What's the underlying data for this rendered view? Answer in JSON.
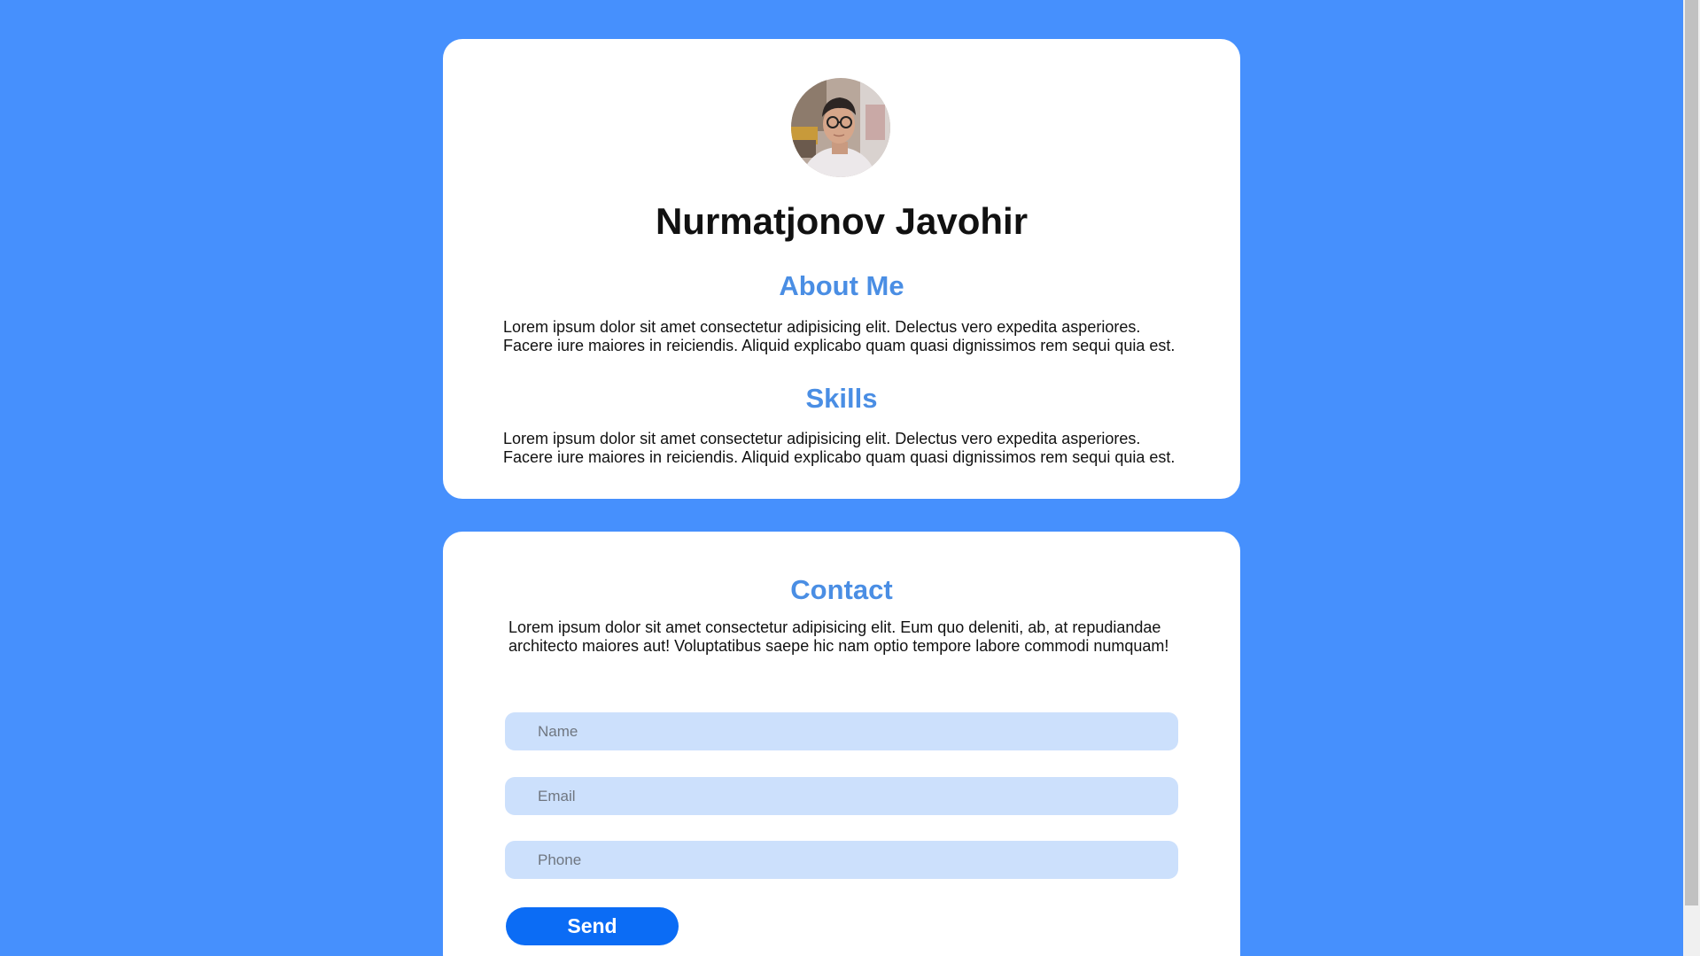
{
  "profile": {
    "name": "Nurmatjonov Javohir",
    "avatar_icon": "profile-photo"
  },
  "about": {
    "heading": "About Me",
    "text": "Lorem ipsum dolor sit amet consectetur adipisicing elit. Delectus vero expedita asperiores. Facere iure maiores in reiciendis. Aliquid explicabo quam quasi dignissimos rem sequi quia est."
  },
  "skills": {
    "heading": "Skills",
    "text": "Lorem ipsum dolor sit amet consectetur adipisicing elit. Delectus vero expedita asperiores. Facere iure maiores in reiciendis. Aliquid explicabo quam quasi dignissimos rem sequi quia est."
  },
  "contact": {
    "heading": "Contact",
    "text": "Lorem ipsum dolor sit amet consectetur adipisicing elit. Eum quo deleniti, ab, at repudiandae architecto maiores aut! Voluptatibus saepe hic nam optio tempore labore commodi numquam!",
    "name_placeholder": "Name",
    "email_placeholder": "Email",
    "phone_placeholder": "Phone",
    "name_value": "",
    "email_value": "",
    "phone_value": "",
    "send_label": "Send"
  },
  "colors": {
    "page_background": "#4690fd",
    "heading_accent": "#4a8ee4",
    "field_background": "#cce0fc",
    "button_background": "#0b6cf5"
  }
}
